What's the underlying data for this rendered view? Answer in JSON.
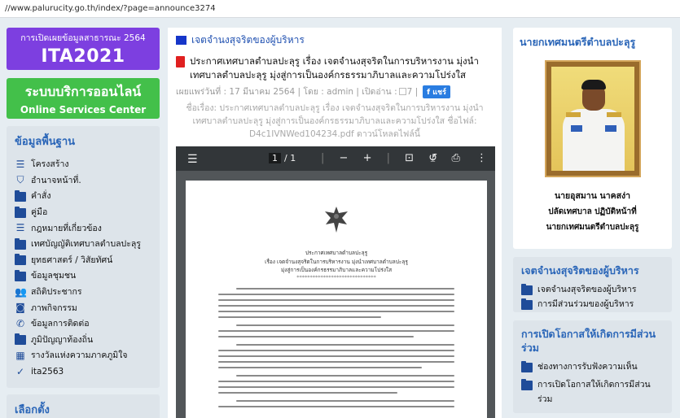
{
  "browser": {
    "url": "//www.palurucity.go.th/index/?page=announce3274"
  },
  "left": {
    "ita": {
      "line1": "การเปิดเผยข้อมูลสาธารณะ 2564",
      "line2": "ITA2021"
    },
    "services": {
      "line1": "ระบบบริการออนไลน์",
      "line2": "Online Services Center"
    },
    "basic_info": {
      "title": "ข้อมูลพื้นฐาน",
      "items": [
        {
          "label": "โครงสร้าง",
          "icon": "list-icon"
        },
        {
          "label": "อำนาจหน้าที่.",
          "icon": "shield-icon"
        },
        {
          "label": "คำสั่ง",
          "icon": "folder-icon"
        },
        {
          "label": "คู่มือ",
          "icon": "folder-icon"
        },
        {
          "label": "กฎหมายที่เกี่ยวข้อง",
          "icon": "list-icon"
        },
        {
          "label": "เทศบัญญัติเทศบาลตำบลปะลุรู",
          "icon": "folder-icon"
        },
        {
          "label": "ยุทธศาสตร์ / วิสัยทัศน์",
          "icon": "folder-icon"
        },
        {
          "label": "ข้อมูลชุมชน",
          "icon": "folder-icon"
        },
        {
          "label": "สถิติประชากร",
          "icon": "users-icon"
        },
        {
          "label": "ภาพกิจกรรม",
          "icon": "camera-icon"
        },
        {
          "label": "ข้อมูลการติดต่อ",
          "icon": "phone-icon"
        },
        {
          "label": "ภูมิปัญญาท้องถิ่น",
          "icon": "folder-icon"
        },
        {
          "label": "รางวัลแห่งความภาคภูมิใจ",
          "icon": "image-icon"
        },
        {
          "label": "ita2563",
          "icon": "check-icon"
        }
      ]
    },
    "election": {
      "title": "เลือกตั้ง"
    }
  },
  "center": {
    "section_title": "เจตจำนงสุจริตของผู้บริหาร",
    "doc_title": "ประกาศเทศบาลตำบลปะลุรู เรื่อง เจตจำนงสุจริตในการบริหารงาน มุ่งนำเทศบาลตำบลปะลุรู มุ่งสู่การเป็นองค์กรธรรมาภิบาลและความโปร่งใส",
    "meta_prefix": "เผยแพร่วันที่ : 17 มีนาคม 2564 | โดย : admin | เปิดอ่าน :",
    "meta_count": "7 |",
    "share_label": "แชร์",
    "desc": "ชื่อเรื่อง: ประกาศเทศบาลตำบลปะลุรู เรื่อง เจตจำนงสุจริตในการบริหารงาน มุ่งนำเทศบาลตำบลปะลุรู มุ่งสู่การเป็นองค์กรธรรมาภิบาลและความโปร่งใส ชื่อไฟล์: D4c1IVNWed104234.pdf ดาวน์โหลดไฟล์นี้",
    "viewer": {
      "page_current": "1",
      "page_total": "/ 1",
      "paper_header": "ประกาศเทศบาลตำบลปะลุรู",
      "paper_subject": "เรื่อง เจตจำนงสุจริตในการบริหารงาน มุ่งนำเทศบาลตำบลปะลุรู",
      "paper_subject2": "มุ่งสู่การเป็นองค์กรธรรมาภิบาลและความโปร่งใส",
      "paper_divider": "******************************"
    }
  },
  "right": {
    "mayor": {
      "title": "นายกเทศมนตรีตำบลปะลุรู",
      "name": "นายอุสมาน นาคสง่า",
      "role": "ปลัดเทศบาล ปฏิบัติหน้าที่",
      "role2": "นายกเทศมนตรีตำบลปะลุรู"
    },
    "integrity": {
      "title": "เจตจำนงสุจริตของผู้บริหาร",
      "links": [
        "เจตจำนงสุจริตของผู้บริหาร",
        "การมีส่วนร่วมของผู้บริหาร"
      ]
    },
    "participation": {
      "title": "การเปิดโอกาสให้เกิดการมีส่วนร่วม",
      "links": [
        "ช่องทางการรับฟังความเห็น",
        "การเปิดโอกาสให้เกิดการมีส่วนร่วม"
      ]
    }
  },
  "colors": {
    "ita_purple": "#7d3fe0",
    "service_green": "#43c04a",
    "heading_blue": "#2b66b8",
    "folder_blue": "#1f4c99",
    "pdf_red": "#e02020"
  }
}
